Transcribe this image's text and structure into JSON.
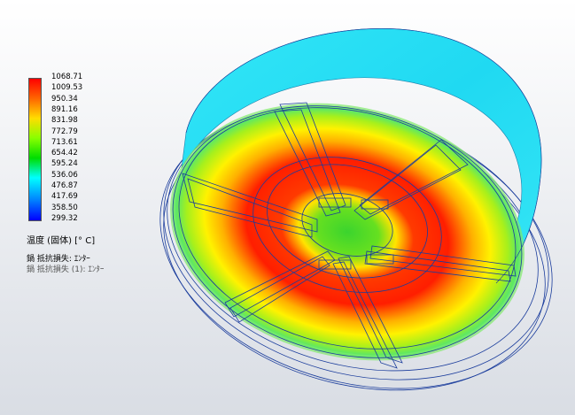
{
  "legend": {
    "ticks": [
      "1068.71",
      "1009.53",
      "950.34",
      "891.16",
      "831.98",
      "772.79",
      "713.61",
      "654.42",
      "595.24",
      "536.06",
      "476.87",
      "417.69",
      "358.50",
      "299.32"
    ],
    "title": "温度 (固体) [° C]",
    "colors": [
      "#ff0000",
      "#ff6600",
      "#ffdd00",
      "#88ff00",
      "#00dd00",
      "#00ffff",
      "#0055ff",
      "#0000ff"
    ]
  },
  "study": {
    "line1": "鍋  抵抗損失: ｴﾝﾀｰ",
    "line2": "鍋  抵抗損失 (1): ｴﾝﾀｰ"
  }
}
